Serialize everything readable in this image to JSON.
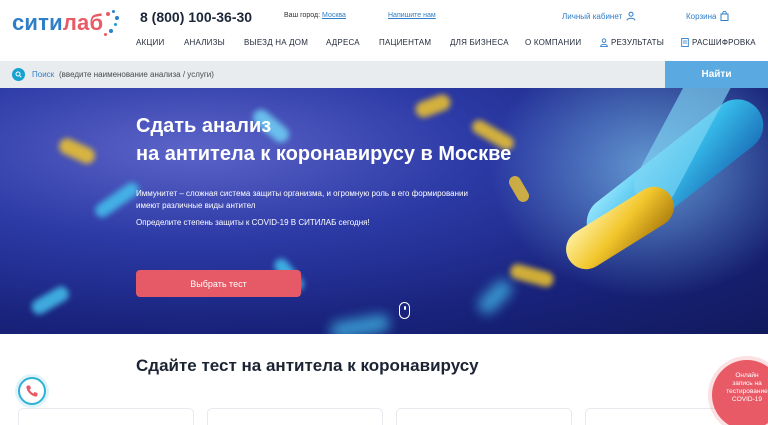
{
  "brand": {
    "logo_part1": "сити",
    "logo_part2": "лаб",
    "phone": "8 (800) 100-36-30",
    "colors": {
      "logo_dark": "#2f7ec7",
      "logo_accent": "#e85a66",
      "accent_blue": "#16a2d0",
      "button_red": "#e55a66"
    }
  },
  "header": {
    "city_label": "Ваш город:",
    "city_value": "Москва",
    "write_us": "Напишите нам",
    "cabinet": "Личный кабинет",
    "cabinet_icon": "user-icon",
    "cart": "Корзина",
    "cart_icon": "bag-icon"
  },
  "nav": {
    "items": [
      {
        "label": "АКЦИИ"
      },
      {
        "label": "АНАЛИЗЫ"
      },
      {
        "label": "ВЫЕЗД НА ДОМ"
      },
      {
        "label": "АДРЕСА"
      },
      {
        "label": "ПАЦИЕНТАМ"
      },
      {
        "label": "ДЛЯ БИЗНЕСА"
      },
      {
        "label": "О КОМПАНИИ"
      },
      {
        "label": "РЕЗУЛЬТАТЫ",
        "icon": "person-icon"
      },
      {
        "label": "РАСШИФРОВКА",
        "icon": "document-icon"
      }
    ]
  },
  "search": {
    "label": "Поиск",
    "placeholder": "(введите наименование анализа / услуги)",
    "button": "Найти"
  },
  "hero": {
    "title_line1": "Сдать анализ",
    "title_line2": "на антитела к коронавирусу в Москве",
    "description": "Иммунитет – сложная система защиты организма, и огромную роль в его формировании имеют различные виды антител",
    "subtext": "Определите степень защиты к COVID-19 В СИТИЛАБ сегодня!",
    "cta": "Выбрать тест"
  },
  "section": {
    "title": "Сдайте тест на антитела к коронавирусу"
  },
  "widgets": {
    "phone_icon": "phone-icon",
    "promo_line1": "Онлайн",
    "promo_line2": "запись на",
    "promo_line3": "тестирование",
    "promo_line4": "COVID-19"
  }
}
